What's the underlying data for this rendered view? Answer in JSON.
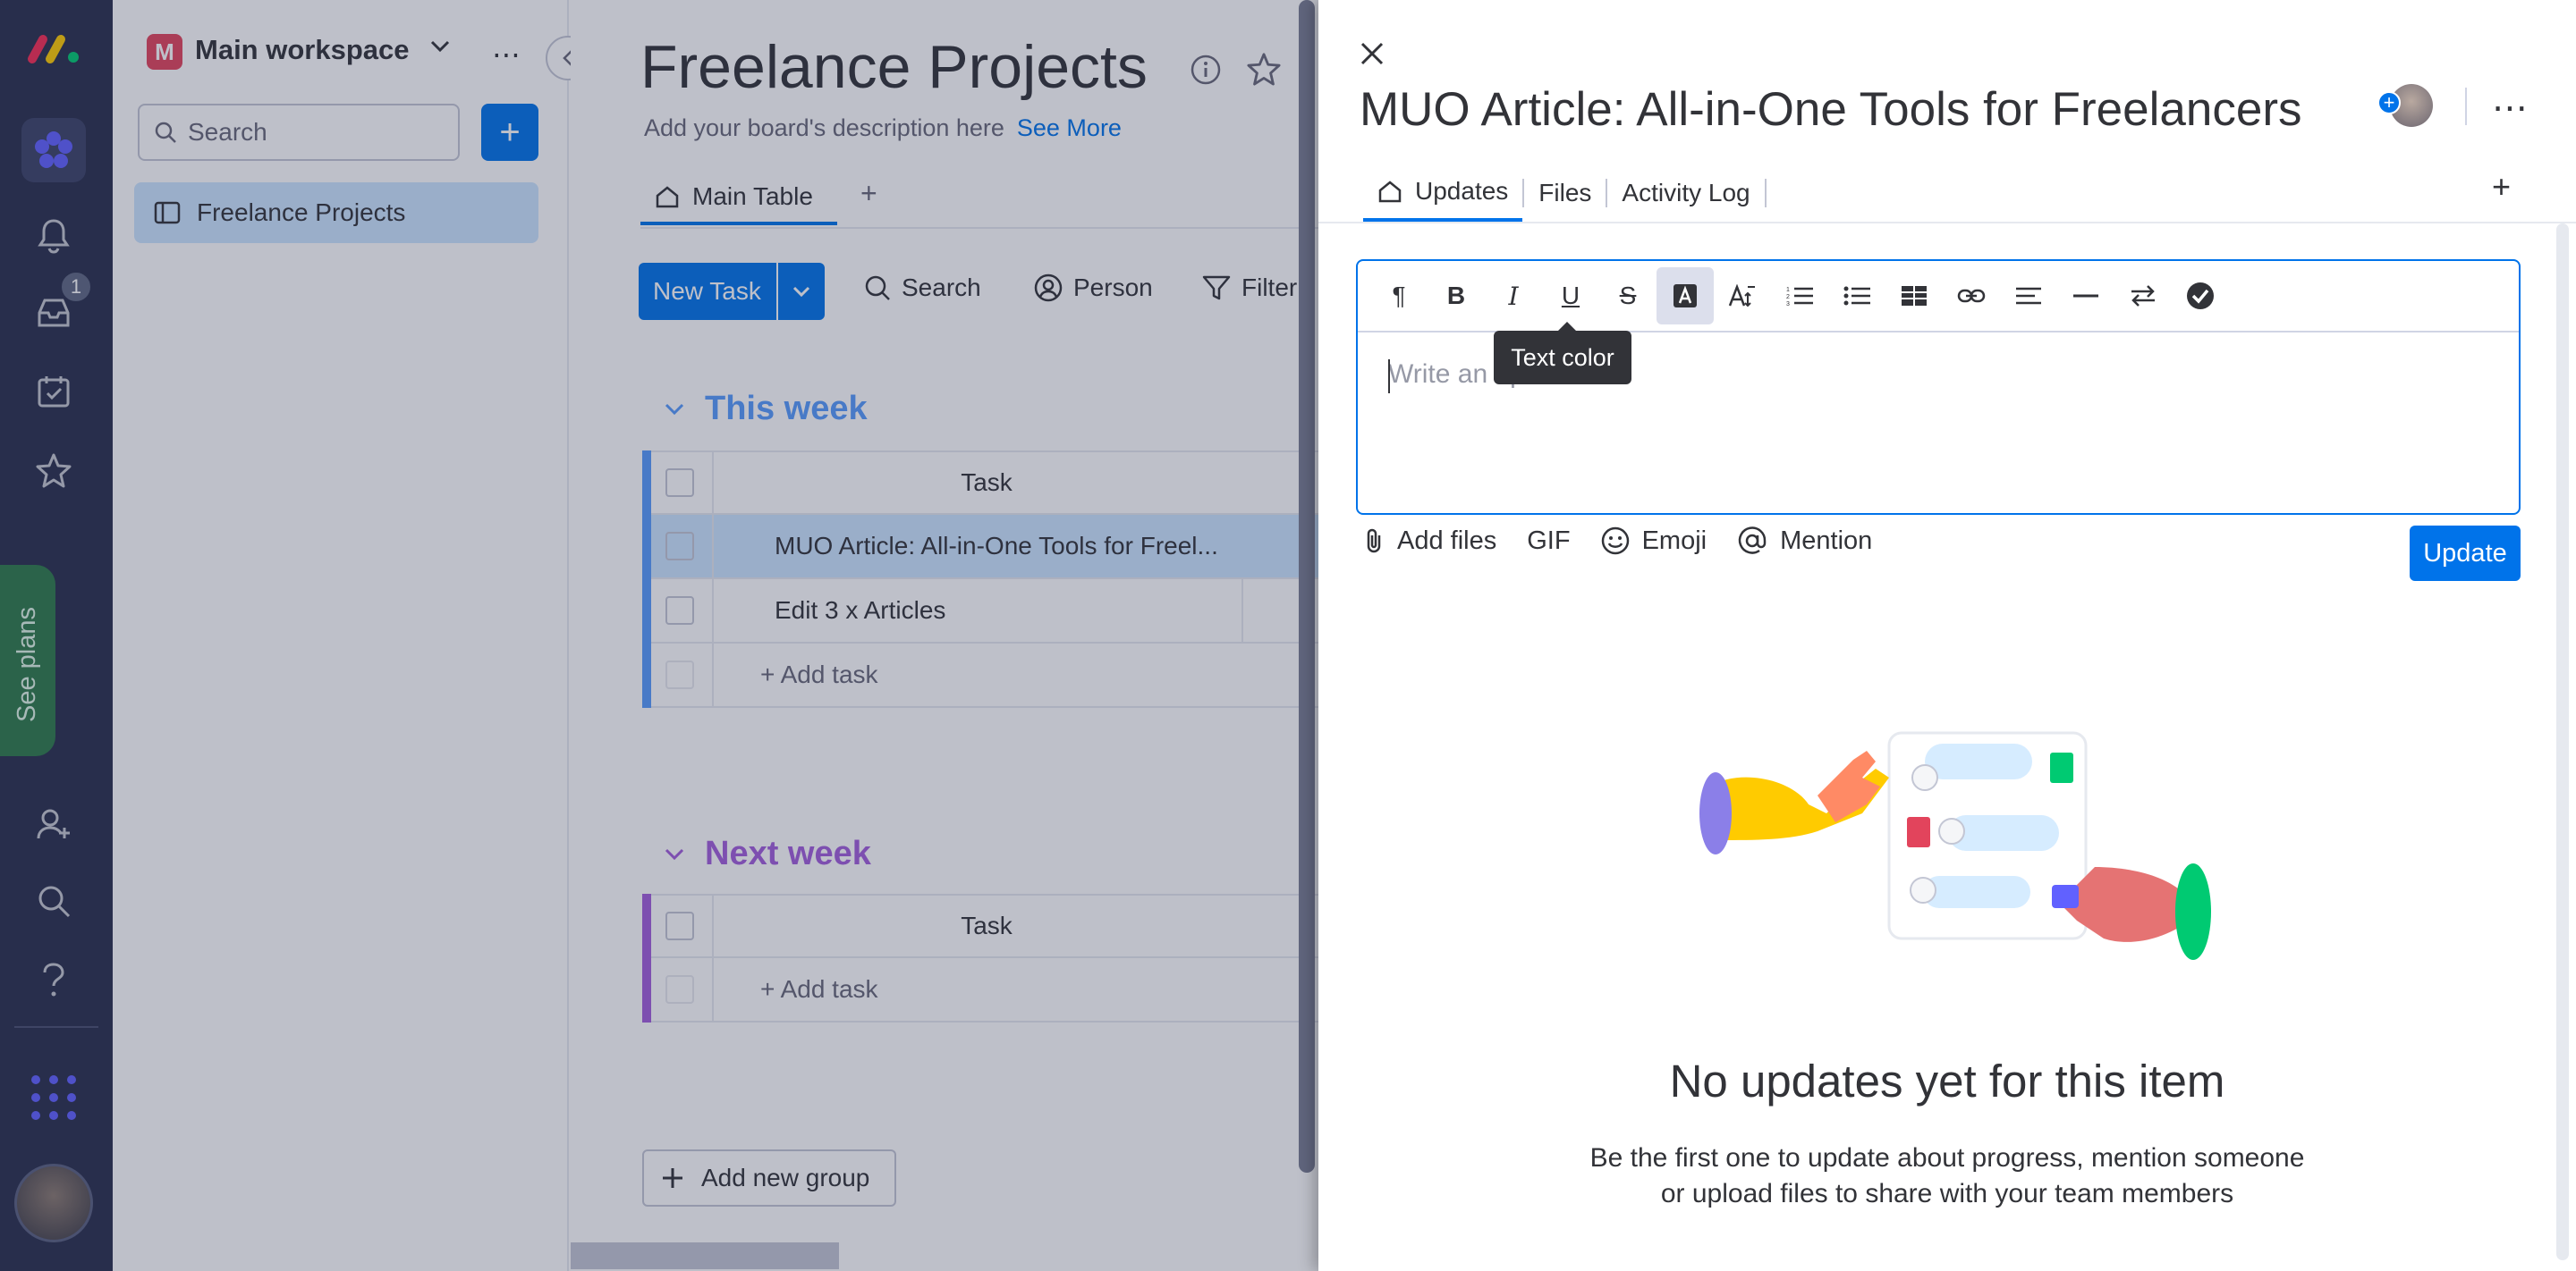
{
  "workspace": {
    "logo_letter": "M",
    "name": "Main workspace",
    "search_placeholder": "Search",
    "boards": [
      {
        "label": "Freelance Projects"
      }
    ]
  },
  "rail": {
    "inbox_count": "1",
    "see_plans": "See plans"
  },
  "board": {
    "title": "Freelance Projects",
    "description": "Add your board's description here",
    "see_more": "See More",
    "view_tab": "Main Table",
    "toolbar": {
      "new_task": "New Task",
      "search": "Search",
      "person": "Person",
      "filter": "Filter"
    },
    "groups": [
      {
        "title": "This week",
        "color": "#579bfc",
        "column": "Task",
        "rows": [
          "MUO Article: All-in-One Tools for Freel...",
          "Edit 3 x Articles"
        ],
        "add_task": "+ Add task"
      },
      {
        "title": "Next week",
        "color": "#a25ddc",
        "column": "Task",
        "rows": [],
        "add_task": "+ Add task"
      }
    ],
    "add_group": "Add new group"
  },
  "panel": {
    "title": "MUO Article: All-in-One Tools for Freelancers",
    "tabs": [
      "Updates",
      "Files",
      "Activity Log"
    ],
    "editor": {
      "placeholder": "Write an update...",
      "tooltip": "Text color",
      "tools": [
        "paragraph-icon",
        "bold-icon",
        "italic-icon",
        "underline-icon",
        "strikethrough-icon",
        "text-color-icon",
        "text-size-icon",
        "numbered-list-icon",
        "bullet-list-icon",
        "table-icon",
        "link-icon",
        "align-icon",
        "divider-icon",
        "direction-icon",
        "checklist-icon"
      ]
    },
    "actions": {
      "add_files": "Add files",
      "gif": "GIF",
      "emoji": "Emoji",
      "mention": "Mention",
      "update": "Update"
    },
    "empty": {
      "title": "No updates yet for this item",
      "line1": "Be the first one to update about progress, mention someone",
      "line2": "or upload files to share with your team members"
    }
  },
  "colors": {
    "accent": "#0073ea",
    "rail": "#292f4c",
    "group_this_week": "#579bfc",
    "group_next_week": "#a25ddc"
  }
}
